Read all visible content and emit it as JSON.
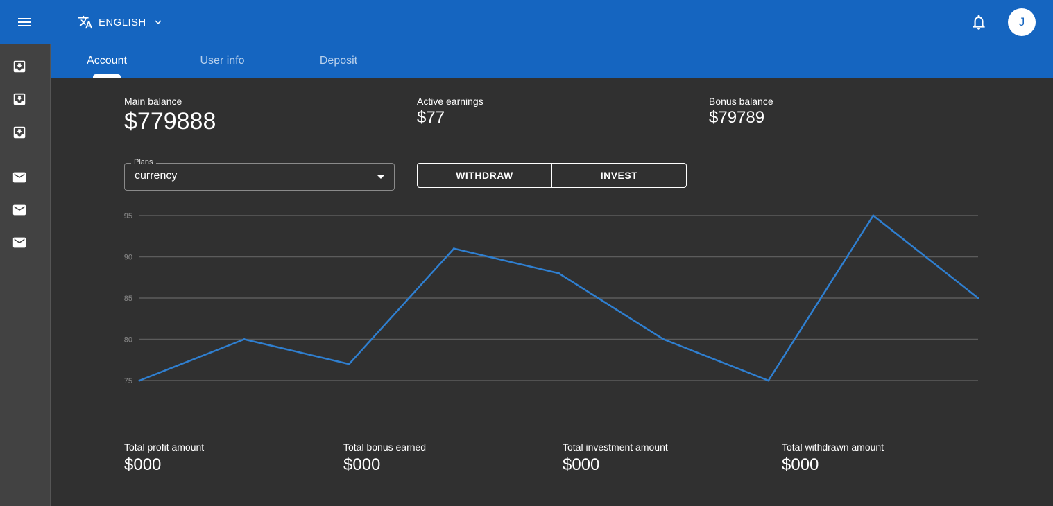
{
  "header": {
    "language_label": "ENGLISH",
    "avatar_initial": "J"
  },
  "tabs": [
    {
      "label": "Account"
    },
    {
      "label": "User info"
    },
    {
      "label": "Deposit"
    }
  ],
  "balances": {
    "main_label": "Main balance",
    "main_value": "$779888",
    "active_label": "Active earnings",
    "active_value": "$77",
    "bonus_label": "Bonus balance",
    "bonus_value": "$79789"
  },
  "plans": {
    "label": "Plans",
    "value": "currency"
  },
  "actions": {
    "withdraw": "WITHDRAW",
    "invest": "INVEST"
  },
  "chart_data": {
    "type": "line",
    "ylim": [
      75,
      95
    ],
    "yticks": [
      "75",
      "80",
      "85",
      "90",
      "95"
    ],
    "values": [
      75,
      80,
      77,
      91,
      88,
      80,
      75,
      95,
      85
    ],
    "line_color": "#2f7fd0",
    "grid": true
  },
  "totals": [
    {
      "label": "Total profit amount",
      "value": "$000"
    },
    {
      "label": "Total bonus earned",
      "value": "$000"
    },
    {
      "label": "Total investment amount",
      "value": "$000"
    },
    {
      "label": "Total withdrawn amount",
      "value": "$000"
    }
  ],
  "colors": {
    "primary": "#1565c0",
    "background": "#303030",
    "sidebar": "#424242"
  }
}
